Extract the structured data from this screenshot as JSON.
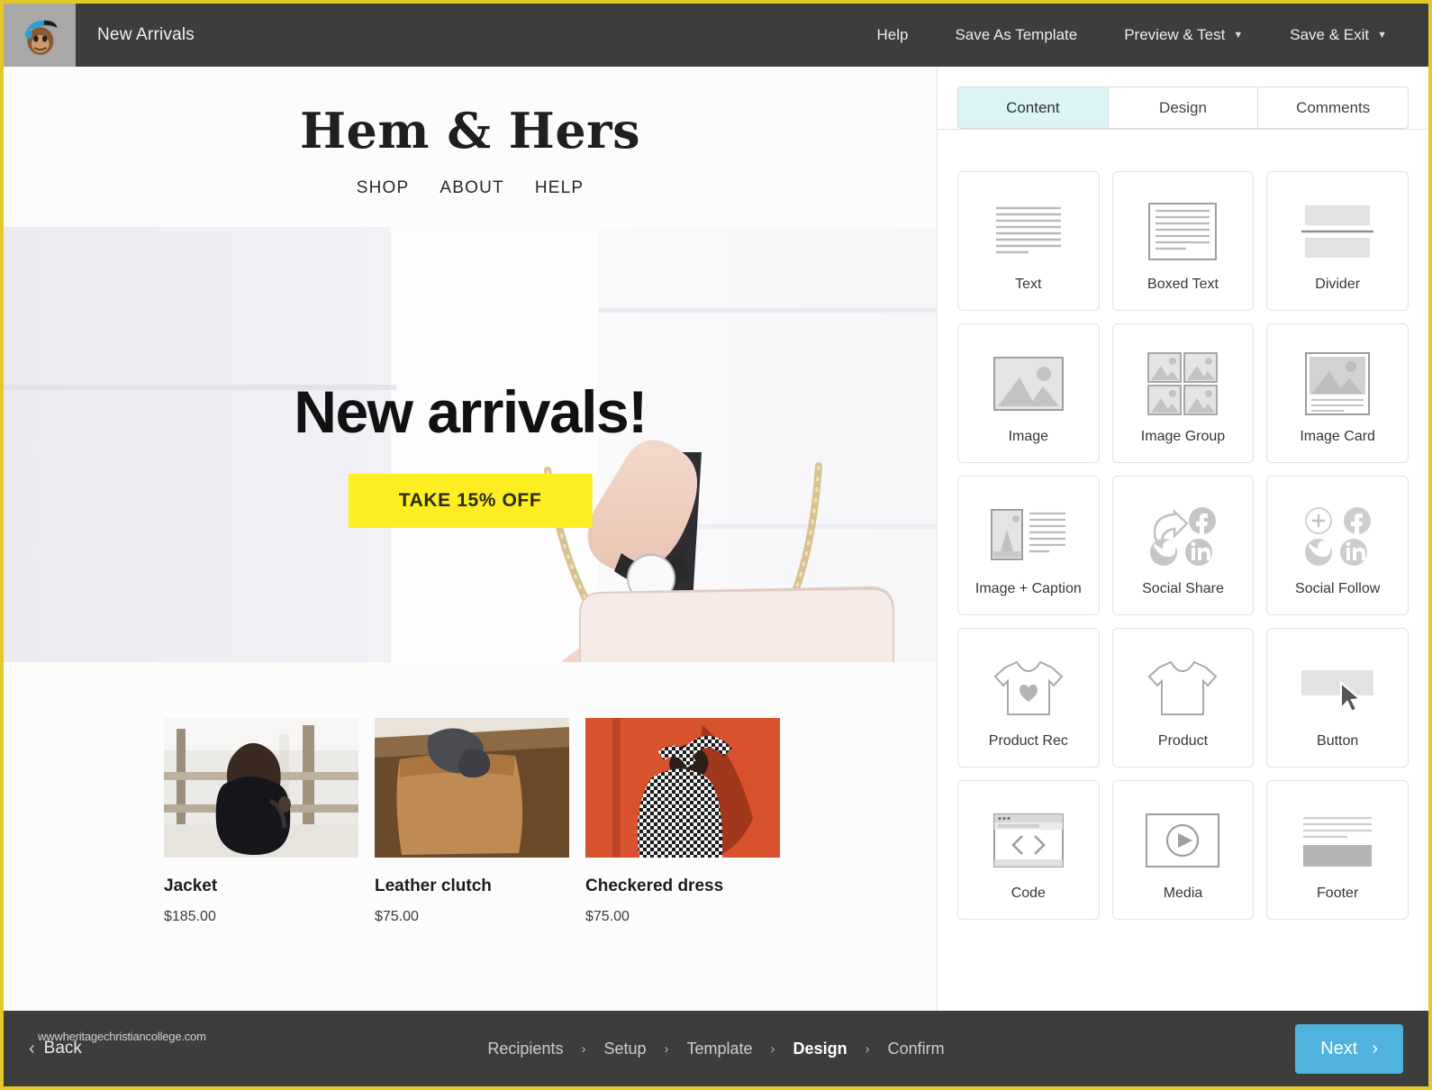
{
  "topbar": {
    "logo_icon": "mailchimp-freddie-icon",
    "campaign_title": "New Arrivals",
    "actions": [
      {
        "label": "Help",
        "caret": ""
      },
      {
        "label": "Save As Template",
        "caret": ""
      },
      {
        "label": "Preview & Test",
        "caret": "⌄"
      },
      {
        "label": "Save & Exit",
        "caret": "⌄"
      }
    ]
  },
  "email": {
    "brand": "Hem & Hers",
    "nav": [
      "SHOP",
      "ABOUT",
      "HELP"
    ],
    "hero": {
      "headline": "New arrivals!",
      "cta_label": "TAKE 15% OFF",
      "cta_bg": "#fcee21",
      "background_description": "woman holding blush leather chain clutch bag"
    },
    "products": [
      {
        "name": "Jacket",
        "price": "$185.00",
        "image": "woman-in-black-leather-jacket"
      },
      {
        "name": "Leather clutch",
        "price": "$75.00",
        "image": "tan-leather-clutch-held-in-gloved-hand"
      },
      {
        "name": "Checkered dress",
        "price": "$75.00",
        "image": "woman-in-checkered-dress-on-orange-wall"
      }
    ]
  },
  "panel": {
    "tabs": [
      {
        "label": "Content",
        "active": true
      },
      {
        "label": "Design",
        "active": false
      },
      {
        "label": "Comments",
        "active": false
      }
    ],
    "active_tab_bg": "#ddf4f6",
    "blocks": [
      {
        "label": "Text",
        "icon": "text-lines-icon"
      },
      {
        "label": "Boxed Text",
        "icon": "boxed-text-icon"
      },
      {
        "label": "Divider",
        "icon": "divider-icon"
      },
      {
        "label": "Image",
        "icon": "image-icon"
      },
      {
        "label": "Image Group",
        "icon": "image-group-icon"
      },
      {
        "label": "Image Card",
        "icon": "image-card-icon"
      },
      {
        "label": "Image + Caption",
        "icon": "image-caption-icon"
      },
      {
        "label": "Social Share",
        "icon": "social-share-icon"
      },
      {
        "label": "Social Follow",
        "icon": "social-follow-icon"
      },
      {
        "label": "Product Rec",
        "icon": "tshirt-heart-icon"
      },
      {
        "label": "Product",
        "icon": "tshirt-icon"
      },
      {
        "label": "Button",
        "icon": "button-cursor-icon"
      },
      {
        "label": "Code",
        "icon": "code-browser-icon"
      },
      {
        "label": "Media",
        "icon": "media-play-icon"
      },
      {
        "label": "Footer",
        "icon": "footer-icon"
      }
    ]
  },
  "bottombar": {
    "back_label": "Back",
    "back_icon": "chevron-left-icon",
    "steps": [
      {
        "label": "Recipients",
        "current": false
      },
      {
        "label": "Setup",
        "current": false
      },
      {
        "label": "Template",
        "current": false
      },
      {
        "label": "Design",
        "current": true
      },
      {
        "label": "Confirm",
        "current": false
      }
    ],
    "step_separator": "›",
    "next_label": "Next",
    "next_icon": "chevron-right-icon",
    "next_bg": "#4fb3dd"
  },
  "watermark": "wwwheritagechristiancollege.com"
}
